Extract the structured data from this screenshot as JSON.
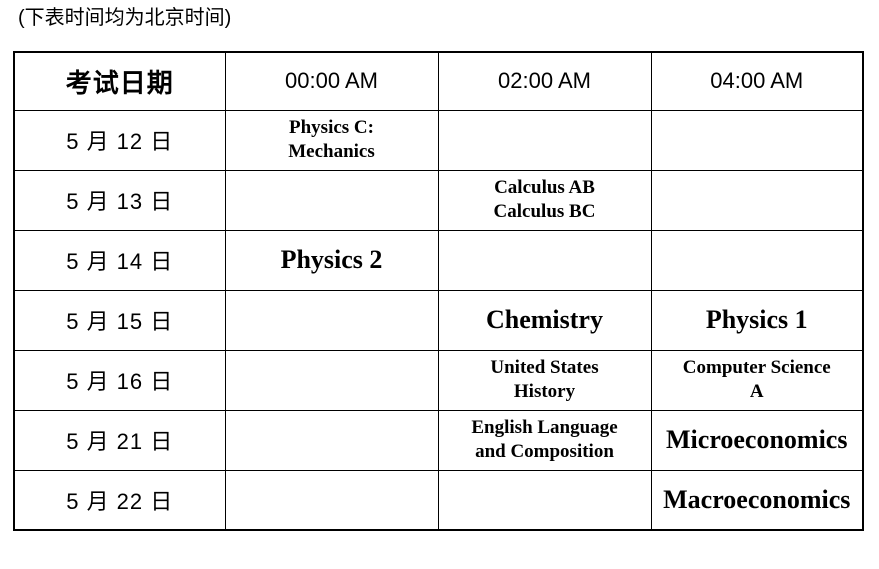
{
  "note": "(下表时间均为北京时间)",
  "table": {
    "columns": [
      {
        "key": "date",
        "label": "考试日期",
        "bold": true
      },
      {
        "key": "t0000",
        "label": "00:00 AM",
        "bold": false
      },
      {
        "key": "t0200",
        "label": "02:00 AM",
        "bold": false
      },
      {
        "key": "t0400",
        "label": "04:00 AM",
        "bold": false
      }
    ],
    "rows": [
      {
        "date": "5 月 12 日",
        "t0000": [
          "Physics C:",
          "Mechanics"
        ],
        "t0200": [],
        "t0400": []
      },
      {
        "date": "5 月 13 日",
        "t0000": [],
        "t0200": [
          "Calculus AB",
          "Calculus BC"
        ],
        "t0400": []
      },
      {
        "date": "5 月 14 日",
        "t0000": [
          "Physics 2"
        ],
        "t0200": [],
        "t0400": []
      },
      {
        "date": "5 月 15 日",
        "t0000": [],
        "t0200": [
          "Chemistry"
        ],
        "t0400": [
          "Physics 1"
        ]
      },
      {
        "date": "5 月 16 日",
        "t0000": [],
        "t0200": [
          "United States",
          "History"
        ],
        "t0400": [
          "Computer Science",
          "A"
        ]
      },
      {
        "date": "5 月 21 日",
        "t0000": [],
        "t0200": [
          "English Language",
          "and Composition"
        ],
        "t0400": [
          "Microeconomics"
        ]
      },
      {
        "date": "5 月 22 日",
        "t0000": [],
        "t0200": [],
        "t0400": [
          "Macroeconomics"
        ]
      }
    ]
  },
  "style": {
    "border_color": "#000000",
    "text_color": "#000000",
    "background": "#ffffff"
  }
}
